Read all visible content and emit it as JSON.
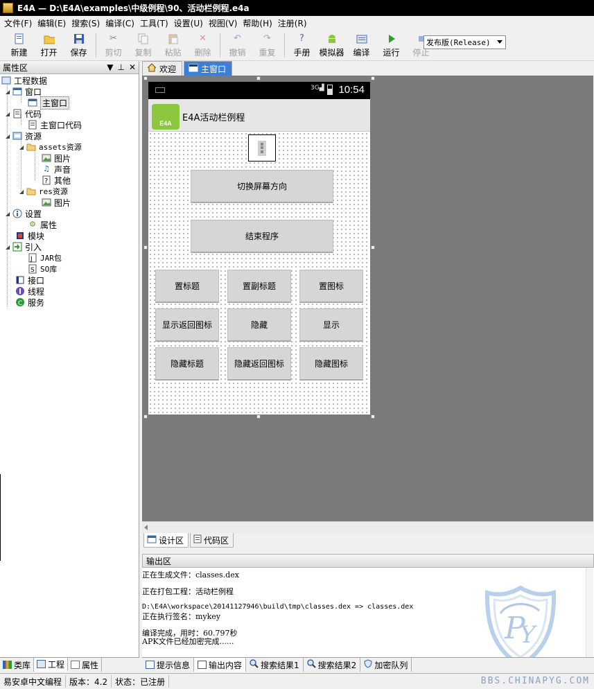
{
  "window": {
    "title": "E4A — D:\\E4A\\examples\\中级例程\\90、活动栏例程.e4a"
  },
  "menu": [
    "文件(F)",
    "编辑(E)",
    "搜索(S)",
    "编译(C)",
    "工具(T)",
    "设置(U)",
    "视图(V)",
    "帮助(H)",
    "注册(R)"
  ],
  "toolbar": {
    "buttons": [
      {
        "label": "新建",
        "icon": "new-file-icon",
        "enabled": true
      },
      {
        "label": "打开",
        "icon": "open-folder-icon",
        "enabled": true
      },
      {
        "label": "保存",
        "icon": "save-icon",
        "enabled": true
      },
      {
        "label": "剪切",
        "icon": "cut-icon",
        "enabled": false
      },
      {
        "label": "复制",
        "icon": "copy-icon",
        "enabled": false
      },
      {
        "label": "粘贴",
        "icon": "paste-icon",
        "enabled": false
      },
      {
        "label": "删除",
        "icon": "delete-icon",
        "enabled": false
      },
      {
        "label": "撤销",
        "icon": "undo-icon",
        "enabled": false
      },
      {
        "label": "重复",
        "icon": "redo-icon",
        "enabled": false
      },
      {
        "label": "手册",
        "icon": "manual-icon",
        "enabled": true
      },
      {
        "label": "模拟器",
        "icon": "android-icon",
        "enabled": true
      },
      {
        "label": "编译",
        "icon": "compile-icon",
        "enabled": true
      },
      {
        "label": "运行",
        "icon": "run-icon",
        "enabled": true
      },
      {
        "label": "停止",
        "icon": "stop-icon",
        "enabled": false
      }
    ],
    "build_mode": "发布版(Release)"
  },
  "properties_panel": {
    "title": "属性区",
    "tree": [
      {
        "label": "工程数据",
        "icon": "project-icon"
      },
      {
        "label": "窗口",
        "icon": "window-icon"
      },
      {
        "label": "主窗口",
        "icon": "window-icon",
        "selected": true
      },
      {
        "label": "代码",
        "icon": "code-file-icon"
      },
      {
        "label": "主窗口代码",
        "icon": "code-file-icon"
      },
      {
        "label": "资源",
        "icon": "resources-icon"
      },
      {
        "label": "assets资源",
        "icon": "folder-icon"
      },
      {
        "label": "图片",
        "icon": "image-icon"
      },
      {
        "label": "声音",
        "icon": "sound-icon"
      },
      {
        "label": "其他",
        "icon": "other-icon"
      },
      {
        "label": "res资源",
        "icon": "folder-icon"
      },
      {
        "label": "图片",
        "icon": "image-icon"
      },
      {
        "label": "设置",
        "icon": "info-icon"
      },
      {
        "label": "属性",
        "icon": "gear-icon"
      },
      {
        "label": "模块",
        "icon": "module-icon"
      },
      {
        "label": "引入",
        "icon": "import-icon"
      },
      {
        "label": "JAR包",
        "icon": "jar-icon"
      },
      {
        "label": "SO库",
        "icon": "so-icon"
      },
      {
        "label": "接口",
        "icon": "interface-icon"
      },
      {
        "label": "线程",
        "icon": "thread-icon"
      },
      {
        "label": "服务",
        "icon": "service-icon"
      }
    ],
    "bottom_tabs": [
      "类库",
      "工程",
      "属性"
    ]
  },
  "designer": {
    "tabs": [
      "欢迎",
      "主窗口"
    ],
    "sub_tabs": [
      "设计区",
      "代码区"
    ],
    "phone": {
      "clock": "10:54",
      "network": "3G",
      "app_title": "E4A活动栏例程",
      "logo_text": "E4A",
      "buttons": {
        "rotate": "切换屏幕方向",
        "exit": "结束程序",
        "grid": [
          "置标题",
          "置副标题",
          "置图标",
          "显示返回图标",
          "隐藏",
          "显示",
          "隐藏标题",
          "隐藏返回图标",
          "隐藏图标"
        ]
      }
    }
  },
  "output": {
    "title": "输出区",
    "lines": [
      "正在生成文件：classes.dex",
      "",
      "正在打包工程：活动栏例程",
      "",
      "D:\\E4A\\workspace\\20141127946\\build\\tmp\\classes.dex => classes.dex",
      "正在执行签名：mykey",
      "",
      "编译完成，用时：60.797秒",
      "APK文件已经加密完成......"
    ],
    "tabs": [
      "提示信息",
      "输出内容",
      "搜索结果1",
      "搜索结果2",
      "加密队列"
    ]
  },
  "statusbar": {
    "product": "易安卓中文编程",
    "version": "版本：4.2",
    "state": "状态：已注册",
    "site": "BBS.CHINAPYG.COM"
  }
}
